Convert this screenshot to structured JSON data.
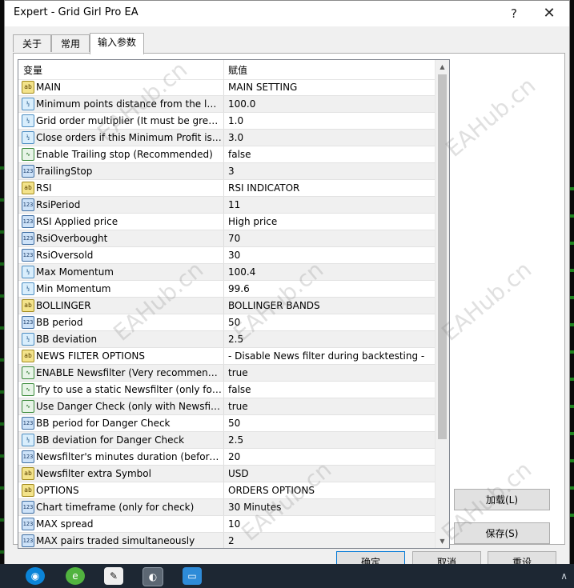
{
  "window": {
    "title": "Expert - Grid Girl Pro EA",
    "help_glyph": "?",
    "close_glyph": "✕"
  },
  "tabs": [
    {
      "label": "关于"
    },
    {
      "label": "常用"
    },
    {
      "label": "输入参数",
      "active": true
    }
  ],
  "grid": {
    "columns": [
      "变量",
      "赋值"
    ],
    "rows": [
      {
        "icon": "ab",
        "icon_name": "string-icon",
        "name": "MAIN",
        "value": "MAIN SETTING"
      },
      {
        "icon": "v2",
        "icon_name": "double-icon",
        "name": "Minimum points distance from the las...",
        "value": "100.0"
      },
      {
        "icon": "v2",
        "icon_name": "double-icon",
        "name": "Grid order multiplier (It must be great...",
        "value": "1.0"
      },
      {
        "icon": "v2",
        "icon_name": "double-icon",
        "name": "Close orders if this Minimum Profit is ...",
        "value": "3.0"
      },
      {
        "icon": "trend",
        "icon_name": "bool-icon",
        "name": "Enable Trailing stop (Recommended)",
        "value": "false"
      },
      {
        "icon": "n123",
        "icon_name": "integer-icon",
        "name": "TrailingStop",
        "value": "3"
      },
      {
        "icon": "ab",
        "icon_name": "string-icon",
        "name": "RSI",
        "value": "RSI INDICATOR"
      },
      {
        "icon": "n123",
        "icon_name": "integer-icon",
        "name": "RsiPeriod",
        "value": "11"
      },
      {
        "icon": "n123",
        "icon_name": "integer-icon",
        "name": "RSI Applied price",
        "value": "High price"
      },
      {
        "icon": "n123",
        "icon_name": "integer-icon",
        "name": "RsiOverbought",
        "value": "70"
      },
      {
        "icon": "n123",
        "icon_name": "integer-icon",
        "name": "RsiOversold",
        "value": "30"
      },
      {
        "icon": "v2",
        "icon_name": "double-icon",
        "name": "Max Momentum",
        "value": "100.4"
      },
      {
        "icon": "v2",
        "icon_name": "double-icon",
        "name": "Min Momentum",
        "value": "99.6"
      },
      {
        "icon": "ab",
        "icon_name": "string-icon",
        "name": "BOLLINGER",
        "value": "BOLLINGER BANDS"
      },
      {
        "icon": "n123",
        "icon_name": "integer-icon",
        "name": "BB period",
        "value": "50"
      },
      {
        "icon": "v2",
        "icon_name": "double-icon",
        "name": "BB deviation",
        "value": "2.5"
      },
      {
        "icon": "ab",
        "icon_name": "string-icon",
        "name": "NEWS FILTER OPTIONS",
        "value": "- Disable News filter during backtesting -"
      },
      {
        "icon": "trend",
        "icon_name": "bool-icon",
        "name": "ENABLE Newsfilter (Very recommende...",
        "value": "true"
      },
      {
        "icon": "trend",
        "icon_name": "bool-icon",
        "name": "Try to use a static Newsfilter (only for ...",
        "value": "false"
      },
      {
        "icon": "trend",
        "icon_name": "bool-icon",
        "name": "Use Danger Check (only with Newsfilt...",
        "value": "true"
      },
      {
        "icon": "n123",
        "icon_name": "integer-icon",
        "name": "BB period for Danger Check",
        "value": "50"
      },
      {
        "icon": "v2",
        "icon_name": "double-icon",
        "name": "BB deviation for Danger Check",
        "value": "2.5"
      },
      {
        "icon": "n123",
        "icon_name": "integer-icon",
        "name": "Newsfilter's minutes duration (before ...",
        "value": "20"
      },
      {
        "icon": "ab",
        "icon_name": "string-icon",
        "name": "Newsfilter extra Symbol",
        "value": "USD"
      },
      {
        "icon": "ab",
        "icon_name": "string-icon",
        "name": "OPTIONS",
        "value": "ORDERS OPTIONS"
      },
      {
        "icon": "n123",
        "icon_name": "integer-icon",
        "name": "Chart timeframe (only for check)",
        "value": "30 Minutes"
      },
      {
        "icon": "n123",
        "icon_name": "integer-icon",
        "name": "MAX spread",
        "value": "10"
      },
      {
        "icon": "n123",
        "icon_name": "integer-icon",
        "name": "MAX pairs traded simultaneously",
        "value": "2"
      }
    ]
  },
  "icon_glyphs": {
    "ab": "ab",
    "v2": "½",
    "trend": "∿",
    "n123": "123"
  },
  "buttons": {
    "load": "加载(L)",
    "save": "保存(S)",
    "ok": "确定",
    "cancel": "取消",
    "reset": "重设"
  },
  "watermark": "EAHub.cn",
  "scroll": {
    "arrow_up": "▲",
    "arrow_down": "▼"
  },
  "taskbar": {
    "arrow": "∧"
  }
}
